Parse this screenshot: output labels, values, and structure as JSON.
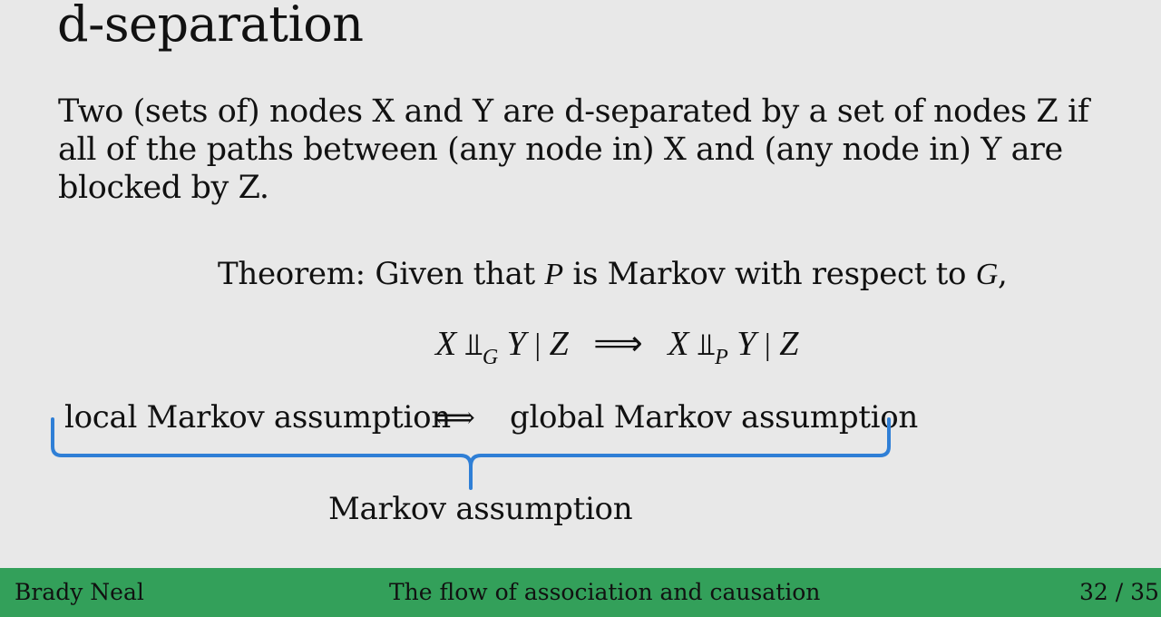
{
  "slide": {
    "title": "d-separation",
    "definition": "Two (sets of) nodes X and Y are d-separated by a set of nodes Z if all of the paths between (any node in) X and (any node in) Y are blocked by Z.",
    "theorem": {
      "prefix": "Theorem: Given that",
      "var_p": "P",
      "middle": "is Markov with respect to",
      "var_g": "G",
      "suffix": ","
    },
    "formula": {
      "x1": "X",
      "indep1": "⫫",
      "sub1": "G",
      "y1": "Y",
      "bar1": "|",
      "z1": "Z",
      "implies": "⟹",
      "x2": "X",
      "indep2": "⫫",
      "sub2": "P",
      "y2": "Y",
      "bar2": "|",
      "z2": "Z"
    },
    "equivalence": {
      "left": "local Markov assumption",
      "symbol": "⟺",
      "right": "global Markov assumption"
    },
    "brace_label": "Markov assumption",
    "brace_color": "#2f7fd6"
  },
  "footer": {
    "author": "Brady Neal",
    "title": "The flow of association and causation",
    "page": "32  /  35",
    "background": "#33a05a"
  }
}
